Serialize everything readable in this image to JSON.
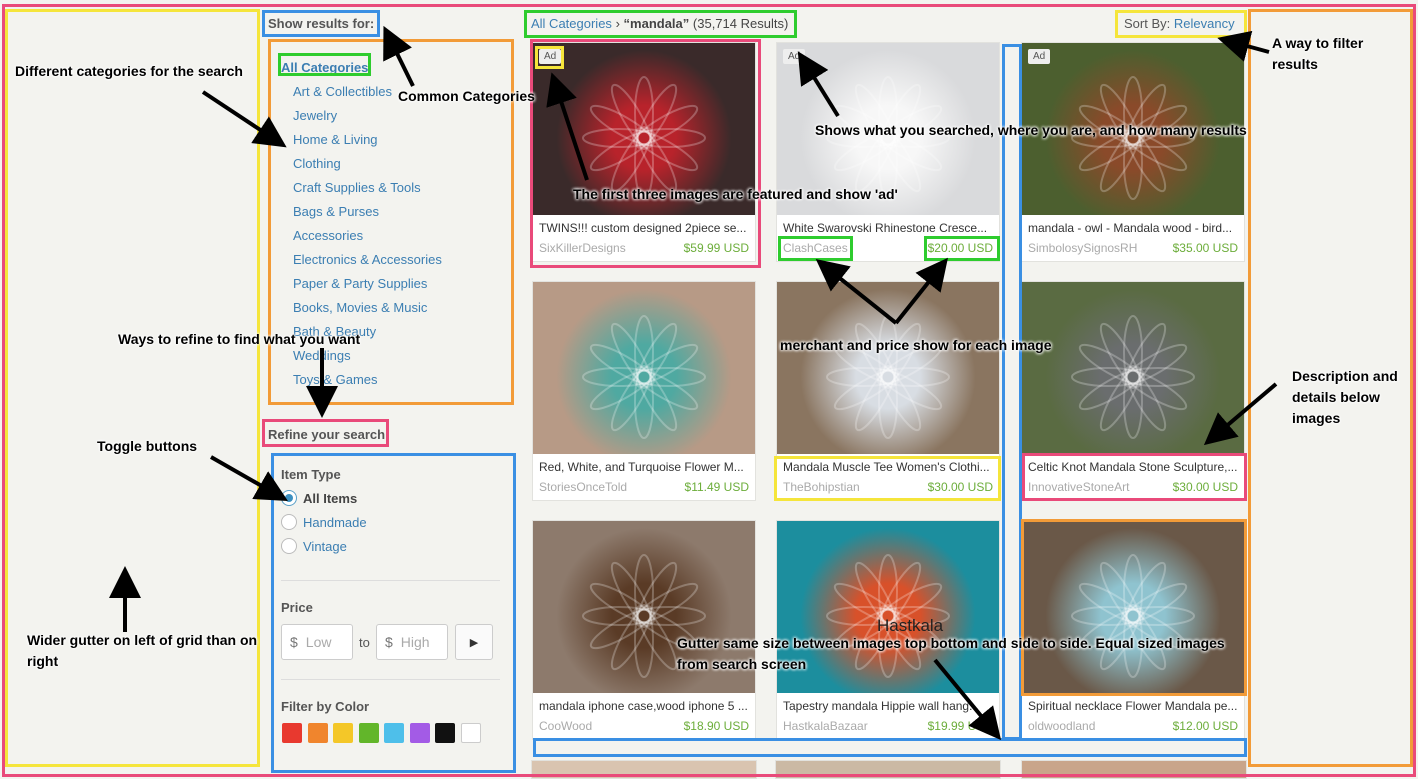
{
  "sidebar": {
    "show_results_label": "Show results for:",
    "categories": [
      {
        "label": "All Categories",
        "level": "all"
      },
      {
        "label": "Art & Collectibles"
      },
      {
        "label": "Jewelry"
      },
      {
        "label": "Home & Living"
      },
      {
        "label": "Clothing"
      },
      {
        "label": "Craft Supplies & Tools"
      },
      {
        "label": "Bags & Purses"
      },
      {
        "label": "Accessories"
      },
      {
        "label": "Electronics & Accessories"
      },
      {
        "label": "Paper & Party Supplies"
      },
      {
        "label": "Books, Movies & Music"
      },
      {
        "label": "Bath & Beauty"
      },
      {
        "label": "Weddings"
      },
      {
        "label": "Toys & Games"
      }
    ],
    "refine_title": "Refine your search",
    "item_type": {
      "label": "Item Type",
      "options": [
        "All Items",
        "Handmade",
        "Vintage"
      ],
      "selected": "All Items"
    },
    "price": {
      "label": "Price",
      "currency": "$",
      "low_placeholder": "Low",
      "to_label": "to",
      "high_placeholder": "High"
    },
    "color_filter": {
      "label": "Filter by Color",
      "colors": [
        "#e8392f",
        "#f0852d",
        "#f4c728",
        "#62b62a",
        "#4ebfea",
        "#a35be6",
        "#111111",
        "#ffffff"
      ]
    }
  },
  "header": {
    "breadcrumb_root": "All Categories",
    "breadcrumb_sep": "›",
    "query": "“mandala”",
    "result_count": "(35,714 Results)",
    "sort_label": "Sort By:",
    "sort_value": "Relevancy"
  },
  "listings": [
    {
      "title": "TWINS!!! custom designed 2piece se...",
      "shop": "SixKillerDesigns",
      "price": "$59.99 USD",
      "ad": "Ad",
      "img_bg": "#3a2a2a",
      "img_fg": "#b8232b"
    },
    {
      "title": "White Swarovski Rhinestone Cresce...",
      "shop": "ClashCases",
      "price": "$20.00 USD",
      "ad": "Ad",
      "img_bg": "#d9dadc",
      "img_fg": "#f7f7f7"
    },
    {
      "title": "mandala - owl - Mandala wood - bird...",
      "shop": "SimbolosySignosRH",
      "price": "$35.00 USD",
      "ad": "Ad",
      "img_bg": "#4c5f2f",
      "img_fg": "#8a4a2a"
    },
    {
      "title": "Red, White, and Turquoise Flower M...",
      "shop": "StoriesOnceTold",
      "price": "$11.49 USD",
      "ad": "",
      "img_bg": "#b79a86",
      "img_fg": "#4fa9a1"
    },
    {
      "title": "Mandala Muscle Tee Women's Clothi...",
      "shop": "TheBohipstian",
      "price": "$30.00 USD",
      "ad": "",
      "img_bg": "#8a7560",
      "img_fg": "#d8dde3"
    },
    {
      "title": "Celtic Knot Mandala Stone Sculpture,...",
      "shop": "InnovativeStoneArt",
      "price": "$30.00 USD",
      "ad": "",
      "img_bg": "#5a6b42",
      "img_fg": "#6a6d6e"
    },
    {
      "title": "mandala iphone case,wood iphone 5 ...",
      "shop": "CooWood",
      "price": "$18.90 USD",
      "ad": "",
      "img_bg": "#8d7a6c",
      "img_fg": "#5a3b26"
    },
    {
      "title": "Tapestry mandala Hippie wall hang...",
      "shop": "HastkalaBazaar",
      "price": "$19.99 USD",
      "ad": "",
      "img_bg": "#1c8e9e",
      "img_fg": "#d8512a"
    },
    {
      "title": "Spiritual necklace Flower Mandala pe...",
      "shop": "oldwoodland",
      "price": "$12.00 USD",
      "ad": "",
      "img_bg": "#6a5848",
      "img_fg": "#8fc3cf"
    }
  ],
  "annotations": {
    "categories_note": "Different categories for the search",
    "common_categories": "Common Categories",
    "refine_note": "Ways to refine to find what you want",
    "toggle_note": "Toggle buttons",
    "gutter_left_note": "Wider gutter on left of grid than on right",
    "search_note": "Shows what you searched, where you are, and how many results",
    "featured_note": "The first three images are featured and show 'ad'",
    "merchant_note": "merchant and price show for each image",
    "filter_note": "A way to filter results",
    "description_note": "Description and details below images",
    "gutter_note": "Gutter same size between images top bottom and side to side. Equal sized images from search screen",
    "tapestry_overlay": "Hastkala"
  }
}
